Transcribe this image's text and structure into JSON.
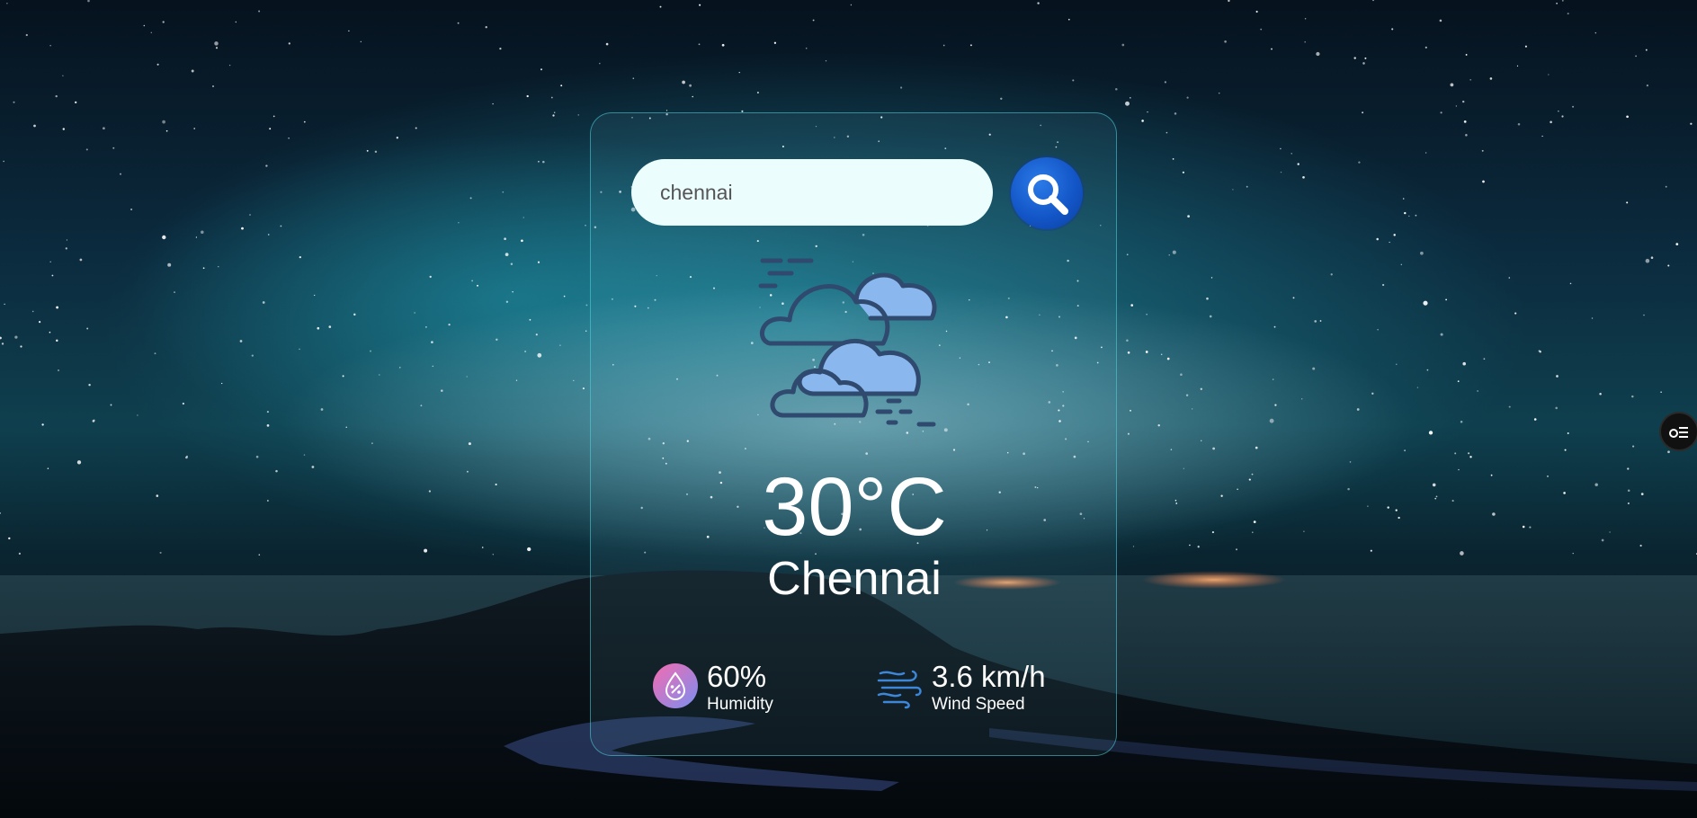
{
  "colors": {
    "card_border": "#50d2dc",
    "search_bg": "#ebfefd",
    "search_button": "#1356c8",
    "text": "#ffffff"
  },
  "search": {
    "value": "chennai",
    "placeholder": "",
    "button_icon": "search-icon"
  },
  "weather": {
    "icon": "clouds-icon",
    "temperature": "30°C",
    "city": "Chennai"
  },
  "stats": {
    "humidity": {
      "icon": "humidity-icon",
      "value": "60%",
      "label": "Humidity"
    },
    "wind": {
      "icon": "wind-icon",
      "value": "3.6 km/h",
      "label": "Wind Speed"
    }
  },
  "side_toggle": {
    "icon": "menu-toggle-icon"
  }
}
